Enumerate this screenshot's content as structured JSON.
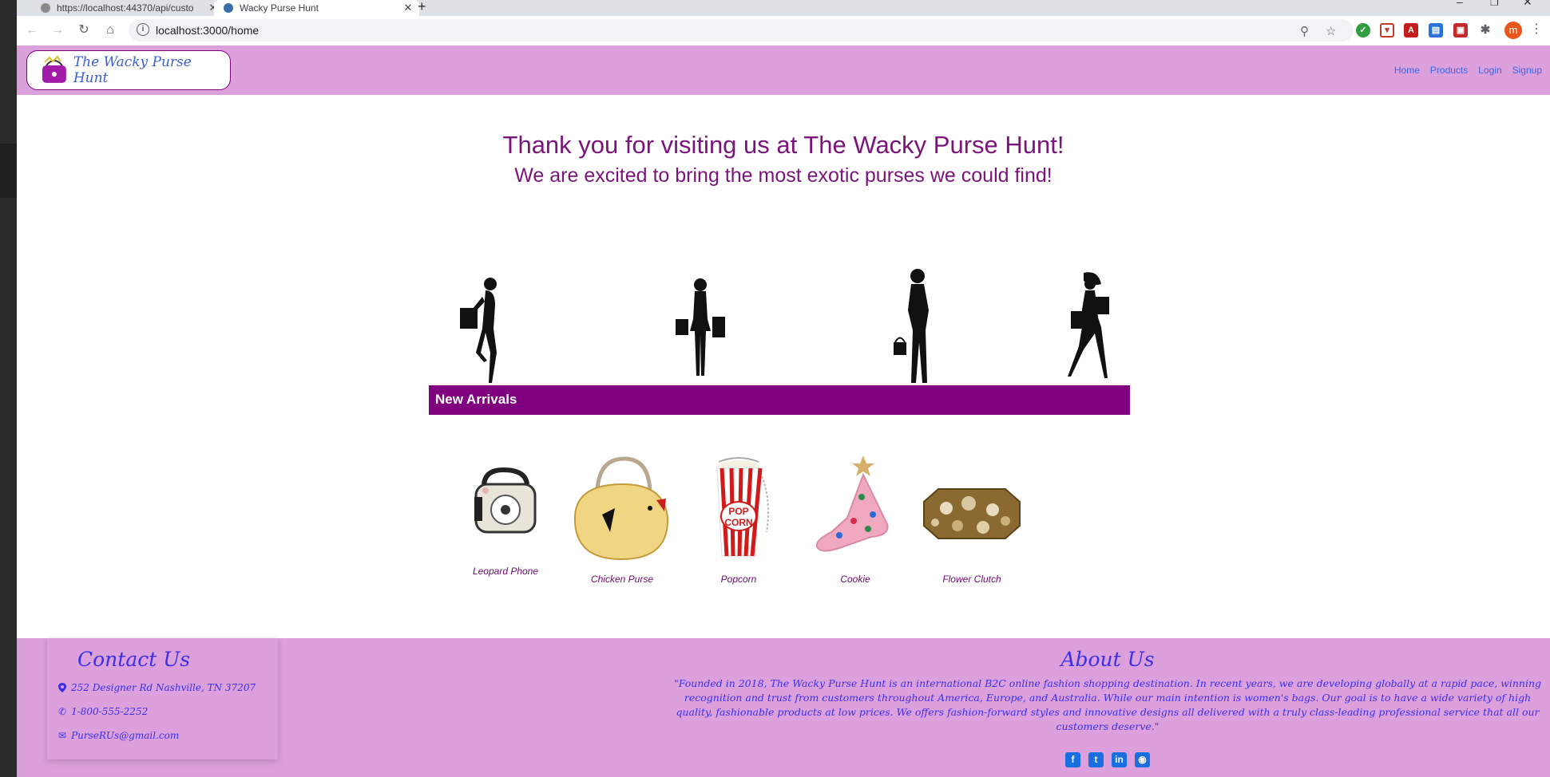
{
  "browser": {
    "tabs": [
      {
        "title": "https://localhost:44370/api/custo",
        "active": false
      },
      {
        "title": "Wacky Purse Hunt",
        "active": true
      }
    ],
    "url": "localhost:3000/home",
    "profile_initial": "m"
  },
  "navbar": {
    "brand": "The Wacky Purse Hunt",
    "links": [
      "Home",
      "Products",
      "Login",
      "Signup"
    ]
  },
  "hero": {
    "title": "Thank you for visiting us at The Wacky Purse Hunt!",
    "subtitle": "We are excited to bring the most exotic purses we could find!"
  },
  "section_banner": "New Arrivals",
  "products": [
    {
      "name": "Leopard Phone",
      "icon": "phone-purse-icon"
    },
    {
      "name": "Chicken Purse",
      "icon": "chicken-purse-icon"
    },
    {
      "name": "Popcorn",
      "icon": "popcorn-purse-icon"
    },
    {
      "name": "Cookie",
      "icon": "cookie-purse-icon"
    },
    {
      "name": "Flower Clutch",
      "icon": "clutch-purse-icon"
    }
  ],
  "footer": {
    "contact_title": "Contact Us",
    "address": "252 Designer Rd Nashville, TN 37207",
    "phone": "1-800-555-2252",
    "email": "PurseRUs@gmail.com",
    "about_title": "About Us",
    "about_text": "\"Founded in 2018, The Wacky Purse Hunt is an international B2C online fashion shopping destination. In recent years, we are developing globally at a rapid pace, winning recognition and trust from customers throughout America, Europe, and Australia. While our main intention is women's bags. Our goal is to have a wide variety of high quality, fashionable products at low prices. We offers fashion-forward styles and innovative designs all delivered with a truly class-leading professional service that all our customers deserve.\"",
    "socials": [
      "facebook-icon",
      "twitter-icon",
      "linkedin-icon",
      "github-icon"
    ]
  },
  "colors": {
    "navbar_bg": "#dca0dc",
    "accent": "#800080",
    "link": "#3b66e8"
  }
}
